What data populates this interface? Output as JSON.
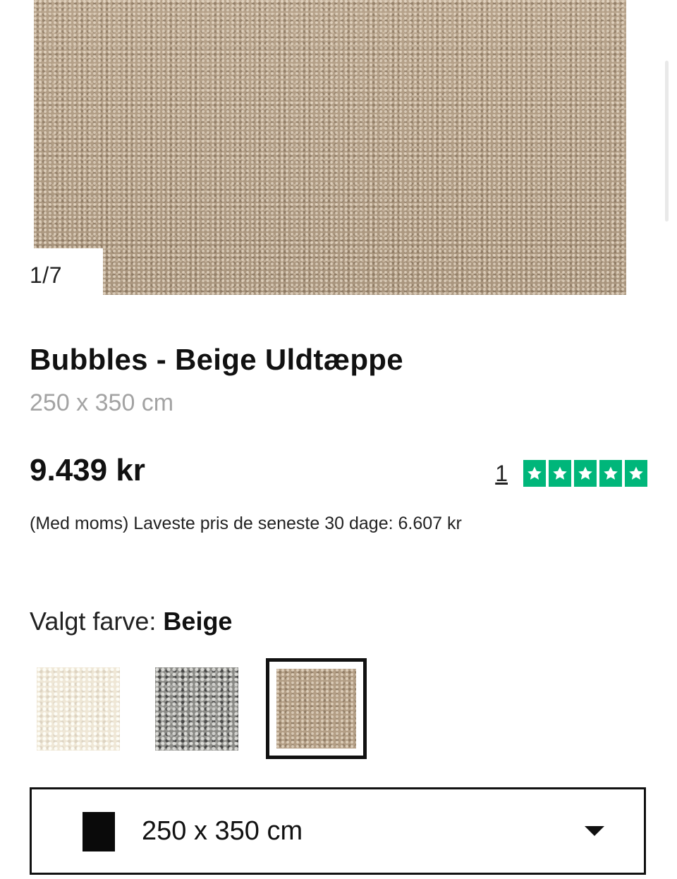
{
  "gallery": {
    "counter": "1/7"
  },
  "product": {
    "title": "Bubbles - Beige Uldtæppe",
    "size": "250 x 350 cm",
    "price": "9.439 kr",
    "vat_note": "(Med moms) Laveste pris de seneste 30 dage: 6.607 kr"
  },
  "rating": {
    "review_count": "1",
    "stars": 5,
    "star_color": "#00b67a"
  },
  "color_selector": {
    "label": "Valgt farve:",
    "selected": "Beige",
    "swatches": [
      "white",
      "grey",
      "beige"
    ]
  },
  "size_selector": {
    "value": "250 x 350 cm",
    "icon": "chevron-down-icon"
  }
}
